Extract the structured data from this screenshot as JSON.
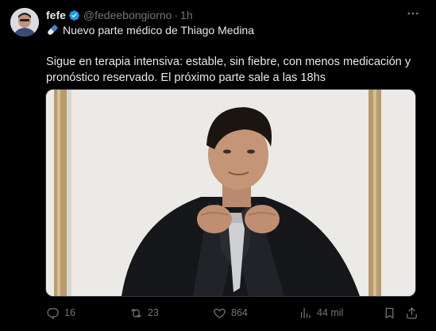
{
  "author": {
    "display_name": "fefe",
    "handle": "@fedeebongiorno",
    "separator": "·",
    "time": "1h",
    "verified": true
  },
  "tweet": {
    "headline": "Nuevo parte médico de Thiago Medina",
    "headline_icon": "pill-emoji",
    "text": "Sigue en terapia intensiva: estable, sin fiebre, con menos medicación y pronóstico reservado. El próximo parte sale a las 18hs"
  },
  "media": {
    "description": "photo-young-man-in-suit-and-tie-inside-frame"
  },
  "actions": {
    "replies": "16",
    "reposts": "23",
    "likes": "864",
    "views": "44 mil"
  },
  "colors": {
    "background": "#000000",
    "text": "#e7e9ea",
    "muted": "#71767b",
    "verified": "#1d9bf0"
  }
}
